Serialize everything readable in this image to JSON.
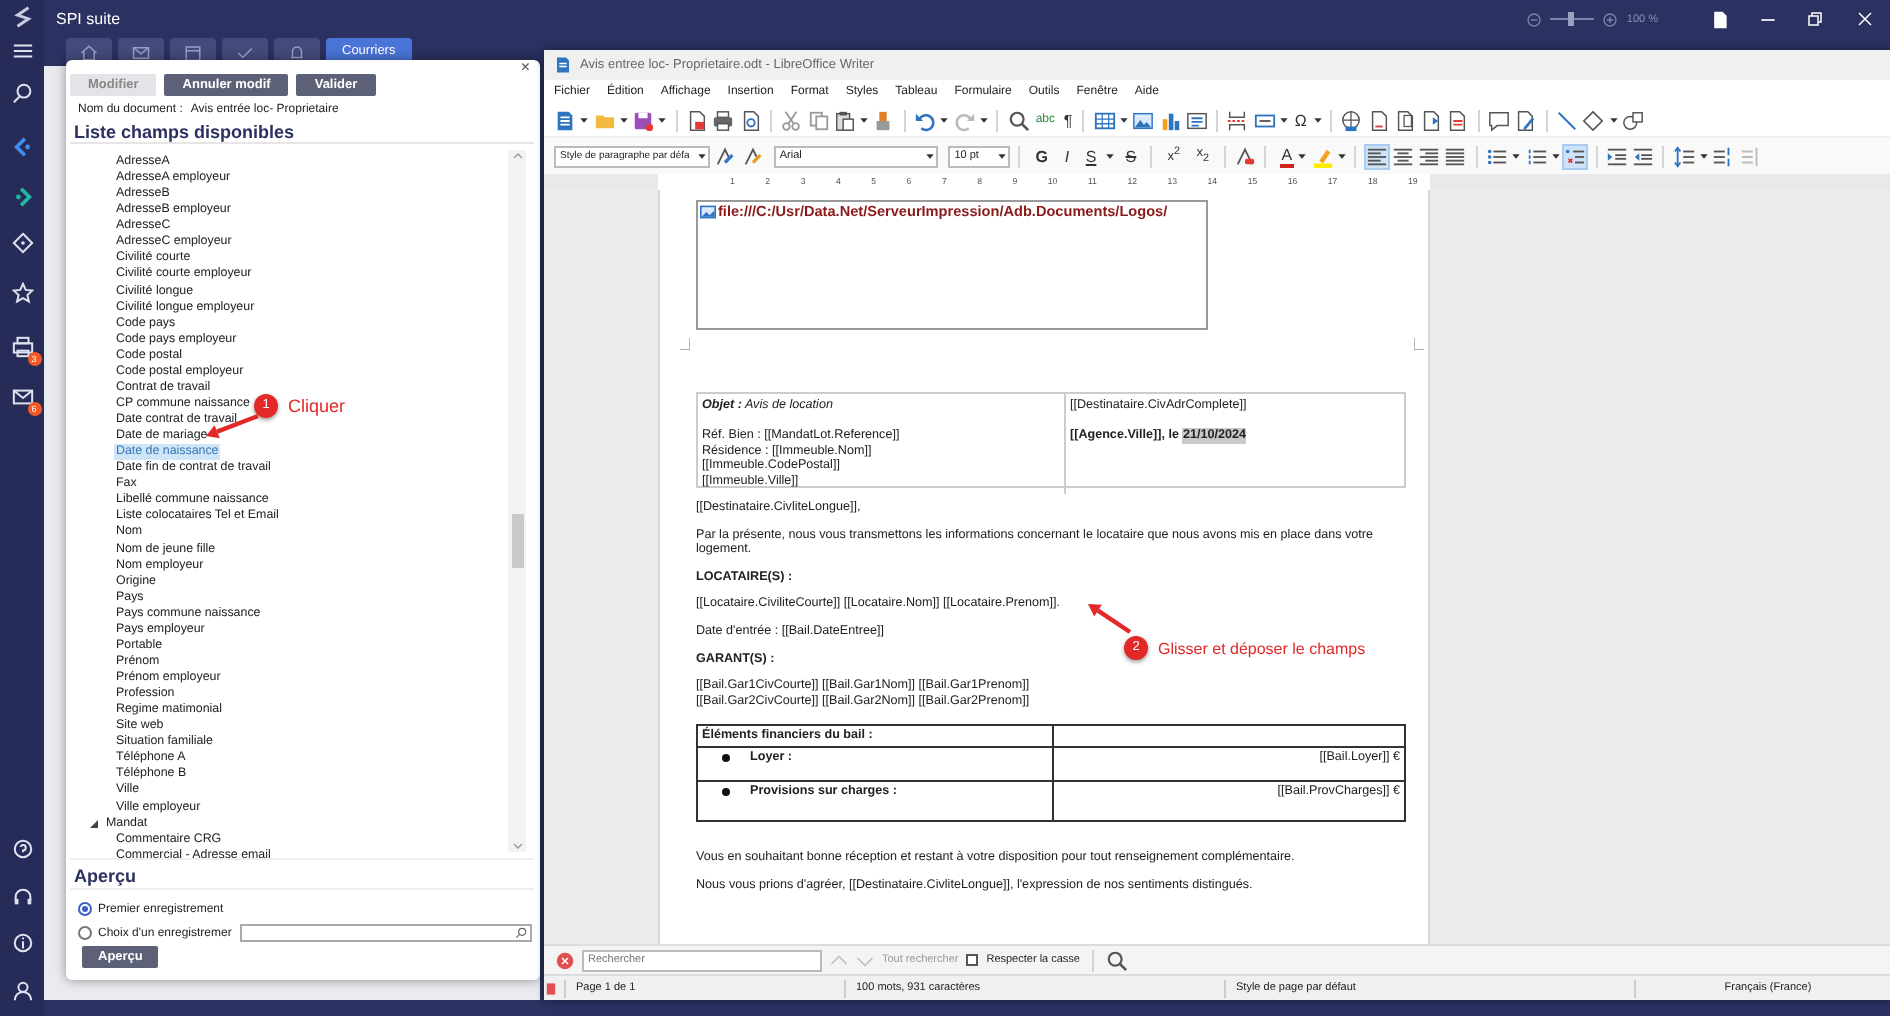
{
  "app": {
    "title": "SPI suite",
    "badges": [
      {
        "count": "3"
      },
      {
        "count": "6"
      }
    ],
    "tabs": [
      {
        "label": "Courriers",
        "selected": true
      }
    ],
    "zoom": {
      "level": 0.45,
      "reading": "100 %"
    }
  },
  "dialog": {
    "close": "×",
    "buttons": [
      {
        "label": "Modifier",
        "disabled": true
      },
      {
        "label": "Annuler modif",
        "disabled": false
      },
      {
        "label": "Valider",
        "disabled": false
      }
    ],
    "document_label": "Nom du document :",
    "document_name": "Avis entrée loc- Proprietaire",
    "list_title": "Liste champs disponibles",
    "fields": [
      {
        "label": "AdresseA",
        "selected": false
      },
      {
        "label": "AdresseA employeur",
        "selected": false
      },
      {
        "label": "AdresseB",
        "selected": false
      },
      {
        "label": "AdresseB employeur",
        "selected": false
      },
      {
        "label": "AdresseC",
        "selected": false
      },
      {
        "label": "AdresseC employeur",
        "selected": false
      },
      {
        "label": "Civilité courte",
        "selected": false
      },
      {
        "label": "Civilité courte employeur",
        "selected": false
      },
      {
        "label": "Civilité longue",
        "selected": false
      },
      {
        "label": "Civilité longue employeur",
        "selected": false
      },
      {
        "label": "Code pays",
        "selected": false
      },
      {
        "label": "Code pays employeur",
        "selected": false
      },
      {
        "label": "Code postal",
        "selected": false
      },
      {
        "label": "Code postal employeur",
        "selected": false
      },
      {
        "label": "Contrat de travail",
        "selected": false
      },
      {
        "label": "CP commune naissance",
        "selected": false
      },
      {
        "label": "Date contrat de travail",
        "selected": false
      },
      {
        "label": "Date de mariage",
        "selected": false
      },
      {
        "label": "Date de naissance",
        "selected": true
      },
      {
        "label": "Date fin de contrat de travail",
        "selected": false
      },
      {
        "label": "Fax",
        "selected": false
      },
      {
        "label": "Libellé commune naissance",
        "selected": false
      },
      {
        "label": "Liste colocataires Tel et Email",
        "selected": false
      },
      {
        "label": "Nom",
        "selected": false
      },
      {
        "label": "Nom de jeune fille",
        "selected": false
      },
      {
        "label": "Nom employeur",
        "selected": false
      },
      {
        "label": "Origine",
        "selected": false
      },
      {
        "label": "Pays",
        "selected": false
      },
      {
        "label": "Pays commune naissance",
        "selected": false
      },
      {
        "label": "Pays employeur",
        "selected": false
      },
      {
        "label": "Portable",
        "selected": false
      },
      {
        "label": "Prénom",
        "selected": false
      },
      {
        "label": "Prénom employeur",
        "selected": false
      },
      {
        "label": "Profession",
        "selected": false
      },
      {
        "label": "Regime matimonial",
        "selected": false
      },
      {
        "label": "Site web",
        "selected": false
      },
      {
        "label": "Situation familiale",
        "selected": false
      },
      {
        "label": "Téléphone A",
        "selected": false
      },
      {
        "label": "Téléphone B",
        "selected": false
      },
      {
        "label": "Ville",
        "selected": false
      },
      {
        "label": "Ville employeur",
        "selected": false
      }
    ],
    "groups": [
      {
        "label": "Mandat",
        "expanded": true,
        "children": [
          {
            "label": "Commentaire CRG",
            "selected": false
          },
          {
            "label": "Commercial - Adresse email",
            "selected": false
          }
        ]
      }
    ],
    "preview": {
      "title": "Aperçu",
      "options": [
        {
          "label": "Premier enregistrement",
          "selected": true
        },
        {
          "label": "Choix d'un enregistremer",
          "selected": false
        }
      ],
      "button": "Aperçu"
    }
  },
  "annotations": [
    {
      "number": "1",
      "text": "Cliquer"
    },
    {
      "number": "2",
      "text": "Glisser et déposer le champs"
    }
  ],
  "writer": {
    "title": "Avis entree loc- Proprietaire.odt - LibreOffice Writer",
    "menu": [
      "Fichier",
      "Édition",
      "Affichage",
      "Insertion",
      "Format",
      "Styles",
      "Tableau",
      "Formulaire",
      "Outils",
      "Fenêtre",
      "Aide"
    ],
    "standard_toolbar": {
      "spelling": "abc",
      "formatting_marks": "¶",
      "special_character": "Ω"
    },
    "format_toolbar": {
      "paragraph_style": "Style de paragraphe par défa",
      "font": "Arial",
      "size": "10 pt",
      "text_buttons": [
        "G",
        "I",
        "S",
        "S",
        "x$^{2}$",
        "x$_{2}$"
      ],
      "font_color": "A",
      "align_buttons": [
        {
          "selected": true
        },
        {
          "selected": false
        },
        {
          "selected": false
        },
        {
          "selected": false
        }
      ],
      "list_buttons": [
        {
          "selected": false
        },
        {
          "selected": false
        },
        {
          "selected": true
        }
      ]
    },
    "ruler": [
      "1",
      "2",
      "3",
      "4",
      "5",
      "6",
      "7",
      "8",
      "9",
      "10",
      "11",
      "12",
      "13",
      "14",
      "15",
      "16",
      "17",
      "18",
      "19"
    ],
    "document": {
      "logo_path": "file:///C:/Usr/Data.Net/ServeurImpression/Adb.Documents/Logos/",
      "header_left": {
        "subject": "**Objet :** Avis de location",
        "lines": [
          "Réf. Bien :  [[MandatLot.Reference]]",
          "Résidence :  [[Immeuble.Nom]]",
          "[[Immeuble.CodePostal]]",
          "[[Immeuble.Ville]]"
        ]
      },
      "header_right": {
        "recipient": "[[Destinataire.CivAdrComplete]]",
        "place": "[[Agence.Ville]], le",
        "date": "21/10/2024"
      },
      "body": [
        {
          "kind": "para",
          "text": "[[Destinataire.CivliteLongue]],"
        },
        {
          "kind": "para",
          "text": "Par la présente, nous vous transmettons les informations concernant le locataire que nous avons mis en place dans votre logement."
        },
        {
          "kind": "heading",
          "text": "LOCATAIRE(S) :"
        },
        {
          "kind": "para",
          "text": "[[Locataire.CiviliteCourte]] [[Locataire.Nom]] [[Locataire.Prenom]]."
        },
        {
          "kind": "para",
          "text": "Date d'entrée : [[Bail.DateEntree]]"
        },
        {
          "kind": "heading",
          "text": "GARANT(S) :"
        },
        {
          "kind": "lines",
          "lines": [
            "[[Bail.Gar1CivCourte]] [[Bail.Gar1Nom]] [[Bail.Gar1Prenom]]",
            "[[Bail.Gar2CivCourte]] [[Bail.Gar2Nom]] [[Bail.Gar2Prenom]]"
          ]
        },
        {
          "kind": "finance_table",
          "title": "Éléments financiers du bail :",
          "rows": [
            {
              "label": "Loyer :",
              "value": "[[Bail.Loyer]] €"
            },
            {
              "label": "Provisions sur charges :",
              "value": "[[Bail.ProvCharges]] €"
            }
          ]
        },
        {
          "kind": "para",
          "text": "Vous en souhaitant bonne réception et restant à votre disposition pour tout renseignement complémentaire."
        },
        {
          "kind": "para",
          "text": "Nous vous prions d'agréer, [[Destinataire.CivliteLongue]], l'expression de nos sentiments distingués."
        }
      ]
    },
    "find_bar": {
      "placeholder": "Rechercher",
      "find_all": "Tout rechercher",
      "match_case": {
        "label": "Respecter la casse",
        "checked": false
      }
    },
    "status_bar": [
      "Page 1 de 1",
      "100 mots, 931 caractères",
      "Style de page par défaut",
      "Français (France)"
    ]
  }
}
